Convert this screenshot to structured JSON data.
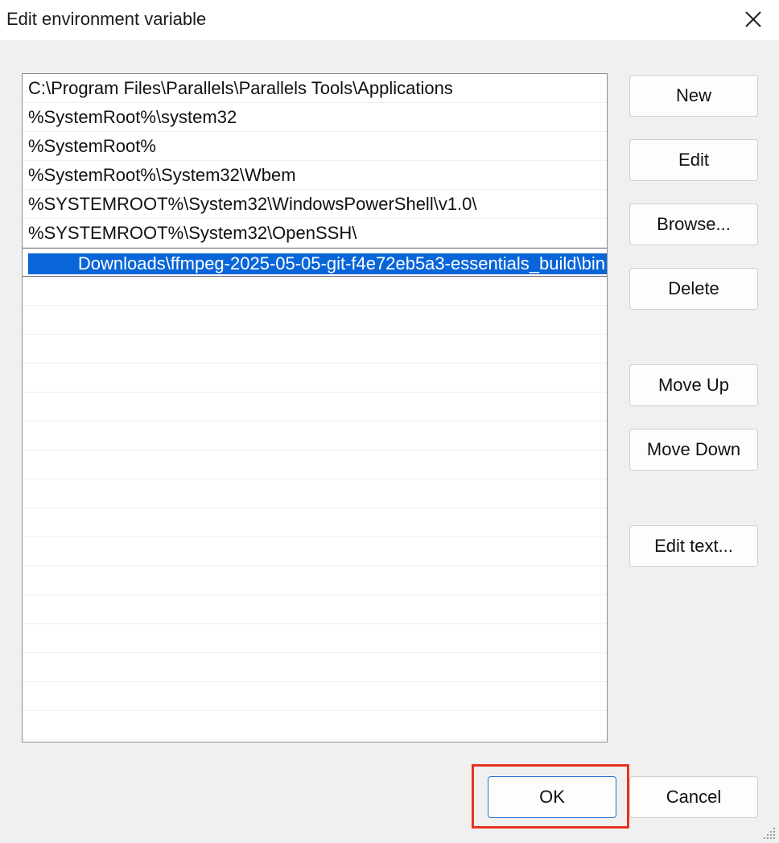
{
  "window": {
    "title": "Edit environment variable",
    "close_icon": "close-icon"
  },
  "list": {
    "items": [
      "C:\\Program Files\\Parallels\\Parallels Tools\\Applications",
      "%SystemRoot%\\system32",
      "%SystemRoot%",
      "%SystemRoot%\\System32\\Wbem",
      "%SYSTEMROOT%\\System32\\WindowsPowerShell\\v1.0\\",
      "%SYSTEMROOT%\\System32\\OpenSSH\\"
    ],
    "editing_value": "Downloads\\ffmpeg-2025-05-05-git-f4e72eb5a3-essentials_build\\bin",
    "empty_rows": 16
  },
  "buttons": {
    "new": "New",
    "edit": "Edit",
    "browse": "Browse...",
    "delete": "Delete",
    "move_up": "Move Up",
    "move_down": "Move Down",
    "edit_text": "Edit text...",
    "ok": "OK",
    "cancel": "Cancel"
  },
  "colors": {
    "selection": "#0a66d8",
    "ok_border": "#1f6fd1",
    "highlight_frame": "#e8321e"
  }
}
